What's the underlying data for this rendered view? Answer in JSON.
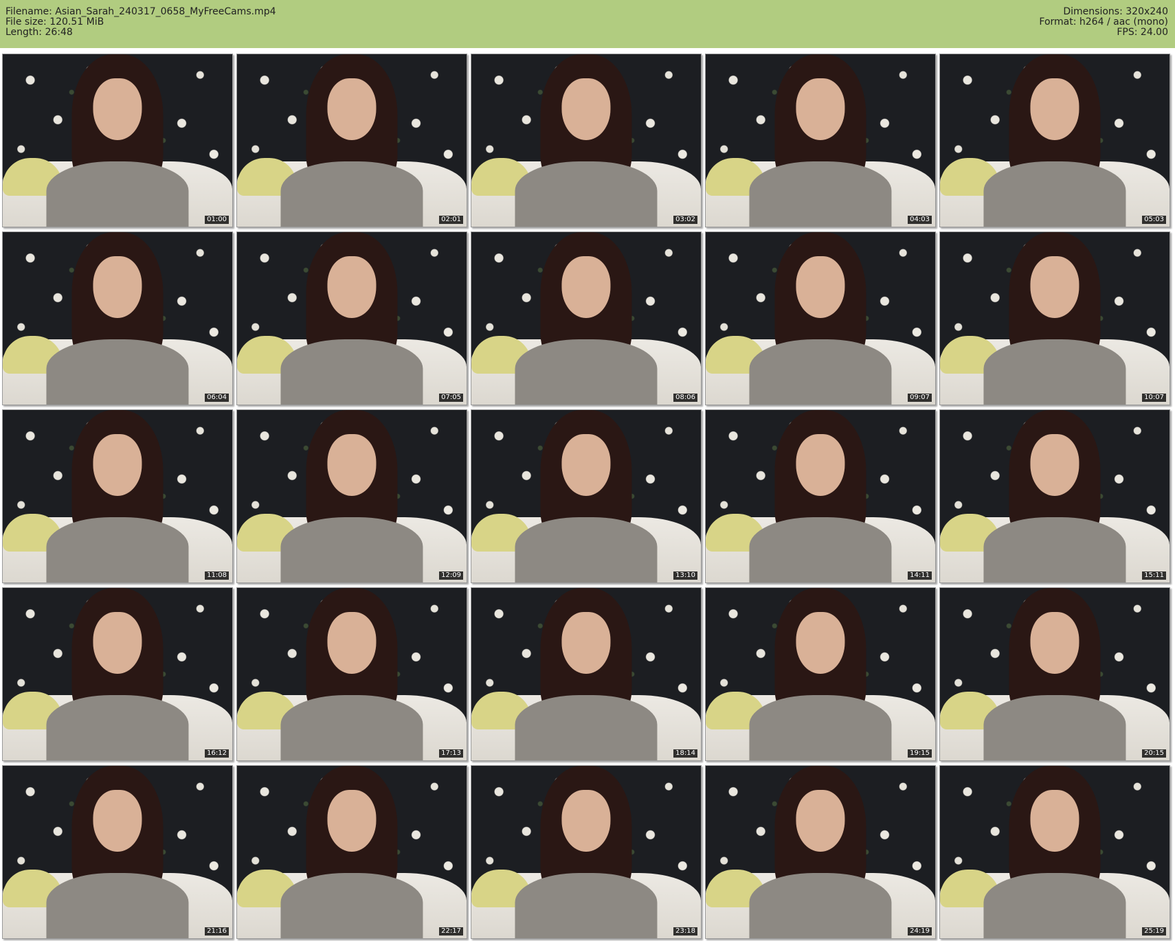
{
  "header": {
    "left": [
      {
        "label": "Filename: ",
        "value": "Asian_Sarah_240317_0658_MyFreeCams.mp4"
      },
      {
        "label": "File size: ",
        "value": "120.51 MiB"
      },
      {
        "label": "Length: ",
        "value": "26:48"
      }
    ],
    "right": [
      {
        "label": "Dimensions: ",
        "value": "320x240"
      },
      {
        "label": "Format: ",
        "value": "h264 / aac (mono)"
      },
      {
        "label": "FPS: ",
        "value": "24.00"
      }
    ]
  },
  "colors": {
    "header_background": "#b1cc80",
    "timestamp_background": "#000000"
  },
  "thumbnails": [
    {
      "timestamp": "01:00"
    },
    {
      "timestamp": "02:01"
    },
    {
      "timestamp": "03:02"
    },
    {
      "timestamp": "04:03"
    },
    {
      "timestamp": "05:03"
    },
    {
      "timestamp": "06:04"
    },
    {
      "timestamp": "07:05"
    },
    {
      "timestamp": "08:06"
    },
    {
      "timestamp": "09:07"
    },
    {
      "timestamp": "10:07"
    },
    {
      "timestamp": "11:08"
    },
    {
      "timestamp": "12:09"
    },
    {
      "timestamp": "13:10"
    },
    {
      "timestamp": "14:11"
    },
    {
      "timestamp": "15:11"
    },
    {
      "timestamp": "16:12"
    },
    {
      "timestamp": "17:13"
    },
    {
      "timestamp": "18:14"
    },
    {
      "timestamp": "19:15"
    },
    {
      "timestamp": "20:15"
    },
    {
      "timestamp": "21:16"
    },
    {
      "timestamp": "22:17"
    },
    {
      "timestamp": "23:18"
    },
    {
      "timestamp": "24:19"
    },
    {
      "timestamp": "25:19"
    }
  ]
}
